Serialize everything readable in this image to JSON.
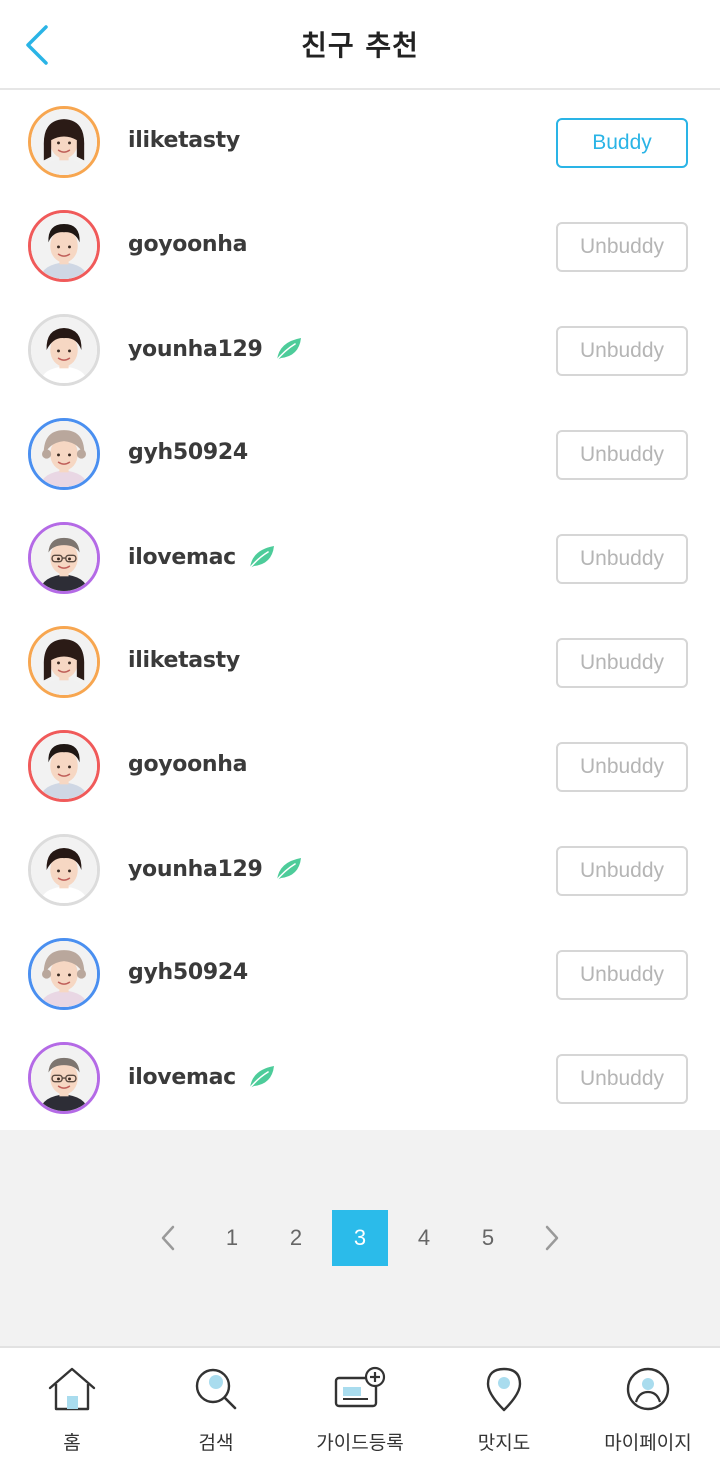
{
  "header": {
    "title": "친구 추천"
  },
  "colors": {
    "accent": "#2ab4e6",
    "leaf": "#4dcc9a",
    "orange": "#f7a650",
    "red": "#f05a5a",
    "gray": "#d9d9d9",
    "blue": "#4a8ff0",
    "purple": "#b46ae6"
  },
  "users": [
    {
      "name": "iliketasty",
      "badge": false,
      "ring": "#f7a650",
      "face": "girl",
      "button": "Buddy",
      "active": true
    },
    {
      "name": "goyoonha",
      "badge": false,
      "ring": "#f05a5a",
      "face": "man",
      "button": "Unbuddy",
      "active": false
    },
    {
      "name": "younha129",
      "badge": true,
      "ring": "#dcdcdc",
      "face": "woman",
      "button": "Unbuddy",
      "active": false
    },
    {
      "name": "gyh50924",
      "badge": false,
      "ring": "#4a8ff0",
      "face": "grandma",
      "button": "Unbuddy",
      "active": false
    },
    {
      "name": "ilovemac",
      "badge": true,
      "ring": "#b46ae6",
      "face": "grandpa",
      "button": "Unbuddy",
      "active": false
    },
    {
      "name": "iliketasty",
      "badge": false,
      "ring": "#f7a650",
      "face": "girl",
      "button": "Unbuddy",
      "active": false
    },
    {
      "name": "goyoonha",
      "badge": false,
      "ring": "#f05a5a",
      "face": "man",
      "button": "Unbuddy",
      "active": false
    },
    {
      "name": "younha129",
      "badge": true,
      "ring": "#dcdcdc",
      "face": "woman",
      "button": "Unbuddy",
      "active": false
    },
    {
      "name": "gyh50924",
      "badge": false,
      "ring": "#4a8ff0",
      "face": "grandma",
      "button": "Unbuddy",
      "active": false
    },
    {
      "name": "ilovemac",
      "badge": true,
      "ring": "#b46ae6",
      "face": "grandpa",
      "button": "Unbuddy",
      "active": false
    }
  ],
  "pagination": {
    "pages": [
      "1",
      "2",
      "3",
      "4",
      "5"
    ],
    "current": "3"
  },
  "tabbar": [
    {
      "label": "홈",
      "icon": "home-icon"
    },
    {
      "label": "검색",
      "icon": "search-icon"
    },
    {
      "label": "가이드등록",
      "icon": "guide-register-icon"
    },
    {
      "label": "맛지도",
      "icon": "map-pin-icon"
    },
    {
      "label": "마이페이지",
      "icon": "profile-icon"
    }
  ]
}
